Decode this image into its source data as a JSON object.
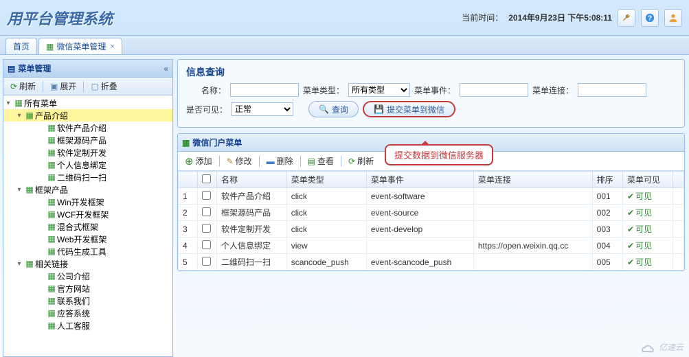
{
  "header": {
    "title": "用平台管理系统",
    "time_label": "当前时间：",
    "time_value": "2014年9月23日 下午5:08:11"
  },
  "tabs": [
    {
      "label": "首页"
    },
    {
      "label": "微信菜单管理"
    }
  ],
  "sidebar": {
    "title": "菜单管理",
    "toolbar": {
      "refresh": "刷新",
      "expand": "展开",
      "collapse": "折叠"
    },
    "tree": {
      "root": "所有菜单",
      "n1": {
        "label": "产品介绍",
        "children": [
          "软件产品介绍",
          "框架源码产品",
          "软件定制开发",
          "个人信息绑定",
          "二维码扫一扫"
        ]
      },
      "n2": {
        "label": "框架产品",
        "children": [
          "Win开发框架",
          "WCF开发框架",
          "混合式框架",
          "Web开发框架",
          "代码生成工具"
        ]
      },
      "n3": {
        "label": "相关链接",
        "children": [
          "公司介绍",
          "官方网站",
          "联系我们",
          "应答系统",
          "人工客服"
        ]
      }
    }
  },
  "search": {
    "title": "信息查询",
    "labels": {
      "name": "名称：",
      "type": "菜单类型：",
      "event": "菜单事件：",
      "link": "菜单连接：",
      "visible": "是否可见："
    },
    "type_value": "所有类型",
    "visible_value": "正常",
    "query_btn": "查询",
    "submit_btn": "提交菜单到微信"
  },
  "callout": "提交数据到微信服务器",
  "grid": {
    "title": "微信门户菜单",
    "toolbar": {
      "add": "添加",
      "edit": "修改",
      "del": "删除",
      "view": "查看",
      "refresh": "刷新"
    },
    "cols": {
      "name": "名称",
      "type": "菜单类型",
      "event": "菜单事件",
      "link": "菜单连接",
      "order": "排序",
      "visible": "菜单可见"
    },
    "rows": [
      {
        "idx": "1",
        "name": "软件产品介绍",
        "type": "click",
        "event": "event-software",
        "link": "",
        "order": "001",
        "visible": "可见"
      },
      {
        "idx": "2",
        "name": "框架源码产品",
        "type": "click",
        "event": "event-source",
        "link": "",
        "order": "002",
        "visible": "可见"
      },
      {
        "idx": "3",
        "name": "软件定制开发",
        "type": "click",
        "event": "event-develop",
        "link": "",
        "order": "003",
        "visible": "可见"
      },
      {
        "idx": "4",
        "name": "个人信息绑定",
        "type": "view",
        "event": "",
        "link": "https://open.weixin.qq.cc",
        "order": "004",
        "visible": "可见"
      },
      {
        "idx": "5",
        "name": "二维码扫一扫",
        "type": "scancode_push",
        "event": "event-scancode_push",
        "link": "",
        "order": "005",
        "visible": "可见"
      }
    ]
  },
  "watermark": "亿速云"
}
